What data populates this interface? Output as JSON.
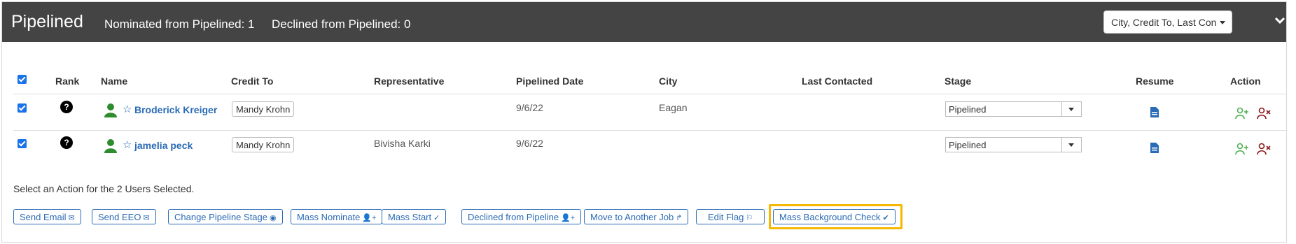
{
  "header": {
    "title": "Pipelined",
    "stat_nominated": "Nominated from Pipelined: 1",
    "stat_declined": "Declined from Pipelined: 0",
    "column_select": "City, Credit To, Last Contacted"
  },
  "table": {
    "columns": [
      "Rank",
      "Name",
      "Credit To",
      "Representative",
      "Pipelined Date",
      "City",
      "Last Contacted",
      "Stage",
      "Resume",
      "Action"
    ],
    "rows": [
      {
        "rank": "?",
        "name": "Broderick Kreiger",
        "credit_to": "Mandy Krohn",
        "representative": "",
        "pipelined_date": "9/6/22",
        "city": "Eagan",
        "last_contacted": "",
        "stage": "Pipelined"
      },
      {
        "rank": "?",
        "name": "jamelia peck",
        "credit_to": "Mandy Krohn",
        "representative": "Bivisha Karki",
        "pipelined_date": "9/6/22",
        "city": "",
        "last_contacted": "",
        "stage": "Pipelined"
      }
    ]
  },
  "selection_message": "Select an Action for the 2 Users Selected.",
  "actions": [
    {
      "label": "Send Email",
      "icon": "envelope-icon",
      "glyph": "✉"
    },
    {
      "label": "Send EEO",
      "icon": "envelope-icon",
      "glyph": "✉"
    },
    {
      "label": "Change Pipeline Stage",
      "icon": "globe-icon",
      "glyph": "◉"
    },
    {
      "label": "Mass Nominate",
      "icon": "user-plus-icon",
      "glyph": "👤+"
    },
    {
      "label": "Mass Start",
      "icon": "check-icon",
      "glyph": "✓"
    },
    {
      "label": "Declined from Pipeline",
      "icon": "user-plus-icon",
      "glyph": "👤+"
    },
    {
      "label": "Move to Another Job",
      "icon": "redo-arrow-icon",
      "glyph": "↱"
    },
    {
      "label": "Edit Flag",
      "icon": "flag-icon",
      "glyph": "⚐"
    },
    {
      "label": "Mass Background Check",
      "icon": "check-circle-icon",
      "glyph": "✔"
    }
  ],
  "colors": {
    "header_bg": "#444444",
    "link": "#2a6bb5",
    "highlight": "#f5b800",
    "checkbox": "#1a73e8",
    "add_green": "#4caf50",
    "remove_red": "#8b1a1a"
  }
}
